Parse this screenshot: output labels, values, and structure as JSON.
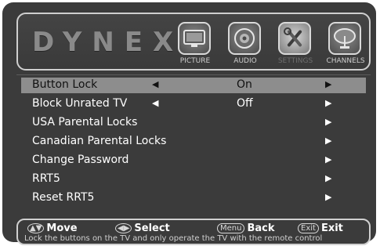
{
  "brand": "DYNEX",
  "menu_tabs": [
    {
      "label": "PICTURE",
      "icon": "tv-icon",
      "active": false
    },
    {
      "label": "AUDIO",
      "icon": "speaker-icon",
      "active": false
    },
    {
      "label": "SETTINGS",
      "icon": "tools-icon",
      "active": true
    },
    {
      "label": "CHANNELS",
      "icon": "satellite-dish-icon",
      "active": false
    }
  ],
  "settings": {
    "rows": [
      {
        "label": "Button Lock",
        "value": "On",
        "selected": true
      },
      {
        "label": "Block Unrated TV",
        "value": "Off",
        "selected": false
      },
      {
        "label": "USA Parental Locks",
        "value": "",
        "selected": false
      },
      {
        "label": "Canadian Parental Locks",
        "value": "",
        "selected": false
      },
      {
        "label": "Change Password",
        "value": "",
        "selected": false
      },
      {
        "label": "RRT5",
        "value": "",
        "selected": false
      },
      {
        "label": "Reset RRT5",
        "value": "",
        "selected": false
      }
    ]
  },
  "footer": {
    "move": "Move",
    "select": "Select",
    "menu_key": "Menu",
    "back": "Back",
    "exit_key": "Exit",
    "exit": "Exit",
    "help_text": "Lock the buttons on the TV and only operate the TV with the remote control"
  },
  "colors": {
    "background": "#3b3b3b",
    "selected_row": "#8d8d8d",
    "text": "#ffffff"
  }
}
